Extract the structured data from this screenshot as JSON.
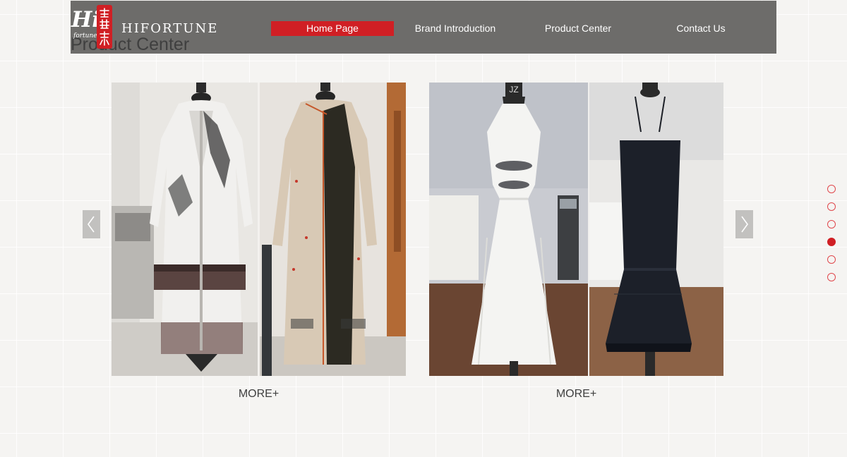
{
  "brand": {
    "hi_text": "Hi",
    "script_text": "fortune",
    "wordmark": "HIFORTUNE",
    "seal_color": "#d01f24"
  },
  "nav": {
    "items": [
      {
        "label": "Home Page",
        "active": true
      },
      {
        "label": "Brand Introduction",
        "active": false
      },
      {
        "label": "Product Center",
        "active": false
      },
      {
        "label": "Contact Us",
        "active": false
      }
    ]
  },
  "section": {
    "title": "Product Center"
  },
  "products": [
    {
      "more_label": "MORE+"
    },
    {
      "more_label": "MORE+"
    }
  ],
  "arrows": {
    "prev_icon": "chevron-left-icon",
    "next_icon": "chevron-right-icon"
  },
  "pagination": {
    "count": 6,
    "active_index": 3
  },
  "colors": {
    "accent": "#d01f24",
    "header_bg": "#6d6c6a",
    "page_bg": "#f5f4f2"
  }
}
